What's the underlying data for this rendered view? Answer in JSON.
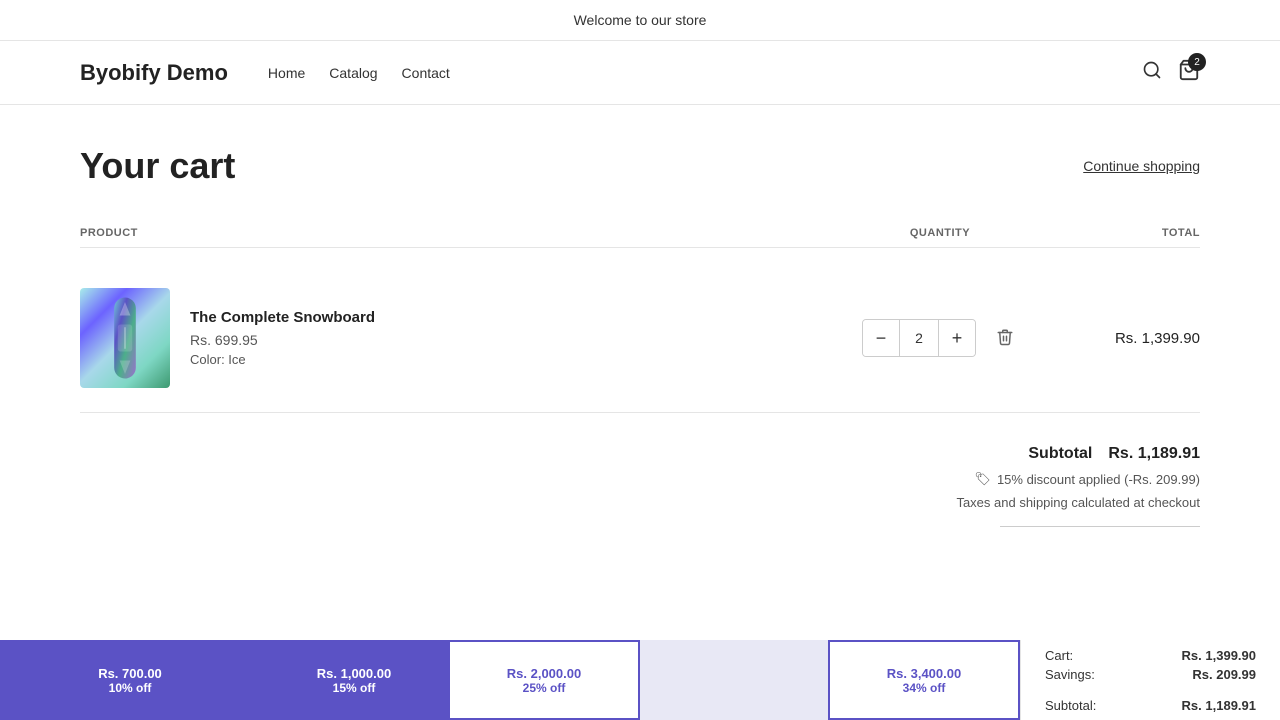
{
  "announcement": {
    "text": "Welcome to our store"
  },
  "header": {
    "logo": "Byobify Demo",
    "nav": [
      {
        "label": "Home"
      },
      {
        "label": "Catalog"
      },
      {
        "label": "Contact"
      }
    ],
    "cart_count": "2"
  },
  "cart": {
    "title": "Your cart",
    "continue_shopping": "Continue shopping",
    "columns": {
      "product": "PRODUCT",
      "quantity": "QUANTITY",
      "total": "TOTAL"
    },
    "items": [
      {
        "name": "The Complete Snowboard",
        "price": "Rs. 699.95",
        "color": "Color: Ice",
        "quantity": "2",
        "total": "Rs. 1,399.90"
      }
    ],
    "subtotal_label": "Subtotal",
    "subtotal_value": "Rs. 1,189.91",
    "discount_text": "15% discount applied (-Rs. 209.99)",
    "taxes_note": "Taxes and shipping calculated at checkout"
  },
  "progress_tiers": [
    {
      "amount": "Rs. 700.00",
      "discount": "10% off",
      "style": "filled"
    },
    {
      "amount": "Rs. 1,000.00",
      "discount": "15% off",
      "style": "filled"
    },
    {
      "amount": "Rs. 2,000.00",
      "discount": "25% off",
      "style": "outline-filled"
    },
    {
      "amount": "",
      "discount": "",
      "style": "empty"
    },
    {
      "amount": "Rs. 3,400.00",
      "discount": "34% off",
      "style": "outline-filled"
    }
  ],
  "summary": {
    "cart_label": "Cart:",
    "cart_value": "Rs. 1,399.90",
    "savings_label": "Savings:",
    "savings_value": "Rs. 209.99",
    "subtotal_label": "Subtotal:",
    "subtotal_value": "Rs. 1,189.91"
  }
}
